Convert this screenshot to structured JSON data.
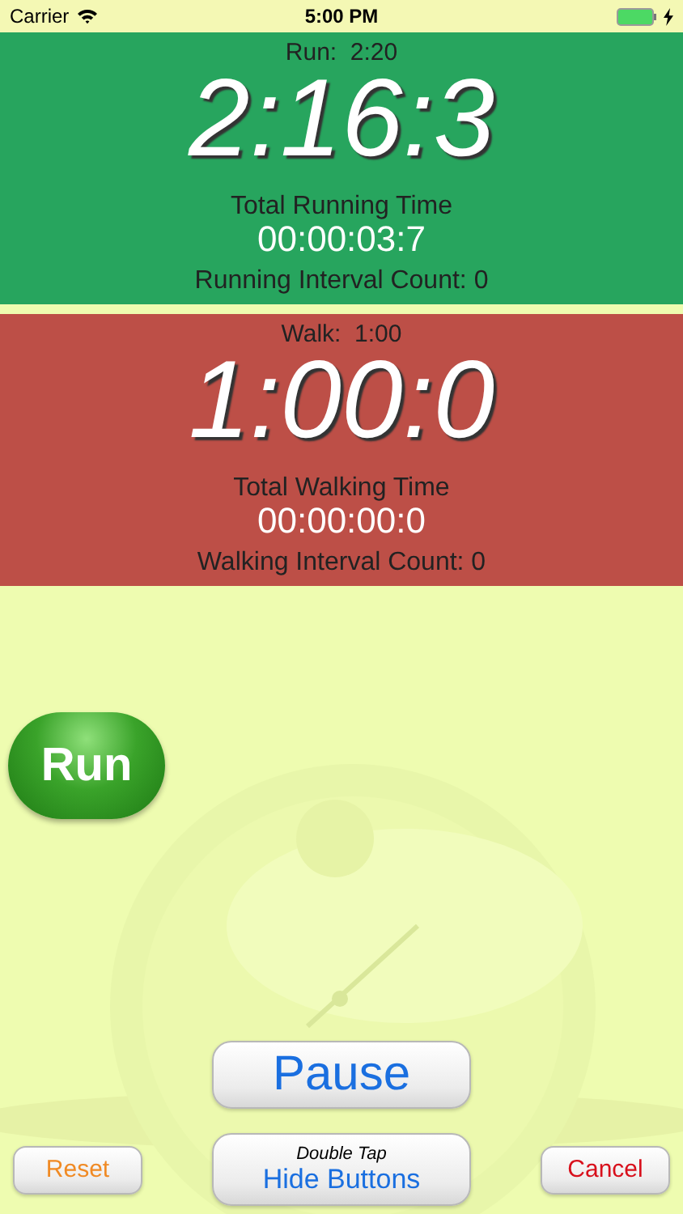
{
  "status_bar": {
    "carrier": "Carrier",
    "time": "5:00 PM"
  },
  "panels": [
    {
      "kind": "run",
      "interval": "Run:  2:20",
      "countdown": "2:16:3",
      "total_label": "Total Running Time",
      "total": "00:00:03:7",
      "count": "Running Interval Count: 0"
    },
    {
      "kind": "walk",
      "interval": "Walk:  1:00",
      "countdown": "1:00:0",
      "total_label": "Total Walking Time",
      "total": "00:00:00:0",
      "count": "Walking Interval Count: 0"
    }
  ],
  "run_button": "Run",
  "pause_button": "Pause",
  "hide_button": {
    "hint": "Double Tap",
    "label": "Hide Buttons"
  },
  "reset_button": "Reset",
  "cancel_button": "Cancel"
}
